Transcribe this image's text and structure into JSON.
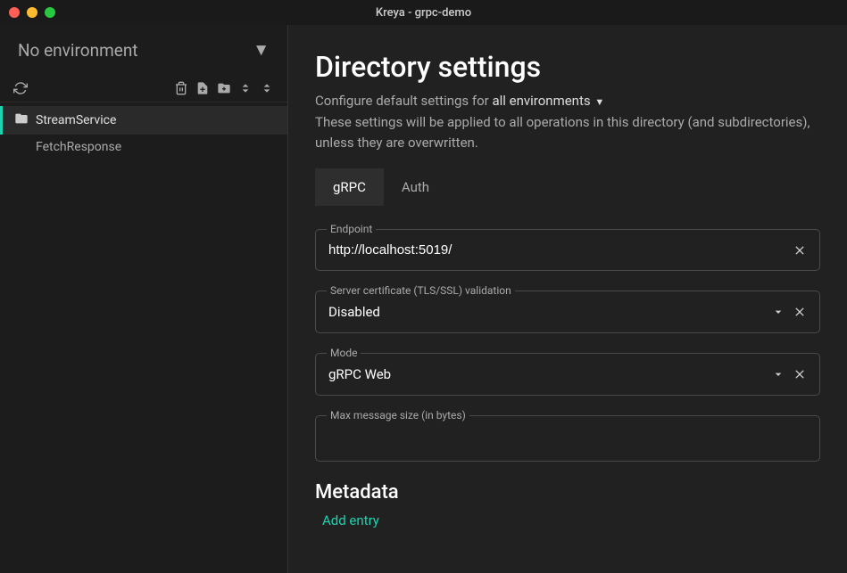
{
  "window": {
    "title": "Kreya - grpc-demo"
  },
  "sidebar": {
    "environment": "No environment",
    "tree": {
      "folder": "StreamService",
      "items": [
        "FetchResponse"
      ]
    }
  },
  "main": {
    "title": "Directory settings",
    "subtitle_prefix": "Configure default settings for ",
    "env_scope": "all environments",
    "description": "These settings will be applied to all operations in this directory (and subdirectories), unless they are overwritten.",
    "tabs": [
      {
        "label": "gRPC",
        "active": true
      },
      {
        "label": "Auth",
        "active": false
      }
    ],
    "fields": {
      "endpoint": {
        "label": "Endpoint",
        "value": "http://localhost:5019/"
      },
      "tls": {
        "label": "Server certificate (TLS/SSL) validation",
        "value": "Disabled"
      },
      "mode": {
        "label": "Mode",
        "value": "gRPC Web"
      },
      "max_message": {
        "label": "Max message size (in bytes)",
        "value": ""
      }
    },
    "metadata": {
      "title": "Metadata",
      "add_entry": "Add entry"
    }
  }
}
